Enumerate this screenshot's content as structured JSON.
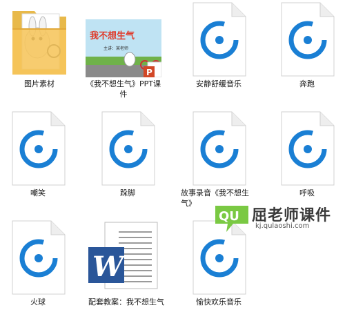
{
  "files": [
    {
      "id": "folder",
      "label": "图片素材",
      "type": "folder"
    },
    {
      "id": "ppt",
      "label": "《我不想生气》PPT课件",
      "type": "ppt",
      "thumb_title": "我不想生气",
      "thumb_sub": "主讲：某老师"
    },
    {
      "id": "audio1",
      "label": "安静舒缓音乐",
      "type": "audio"
    },
    {
      "id": "audio2",
      "label": "奔跑",
      "type": "audio"
    },
    {
      "id": "audio3",
      "label": "嘲笑",
      "type": "audio"
    },
    {
      "id": "audio4",
      "label": "跺脚",
      "type": "audio"
    },
    {
      "id": "audio5",
      "label": "故事录音《我不想生气》",
      "type": "audio"
    },
    {
      "id": "audio6",
      "label": "呼吸",
      "type": "audio"
    },
    {
      "id": "audio7",
      "label": "火球",
      "type": "audio"
    },
    {
      "id": "doc",
      "label": "配套教案：我不想生气",
      "type": "word"
    },
    {
      "id": "audio8",
      "label": "愉快欢乐音乐",
      "type": "audio"
    }
  ],
  "watermark": {
    "text": "屈老师课件",
    "url": "kj.qulaoshi.com",
    "logo": "QU"
  },
  "colors": {
    "audio_blue": "#1a7fd4",
    "folder_yellow": "#f6c55b",
    "word_blue": "#2a5699",
    "ppt_red": "#d24726"
  }
}
